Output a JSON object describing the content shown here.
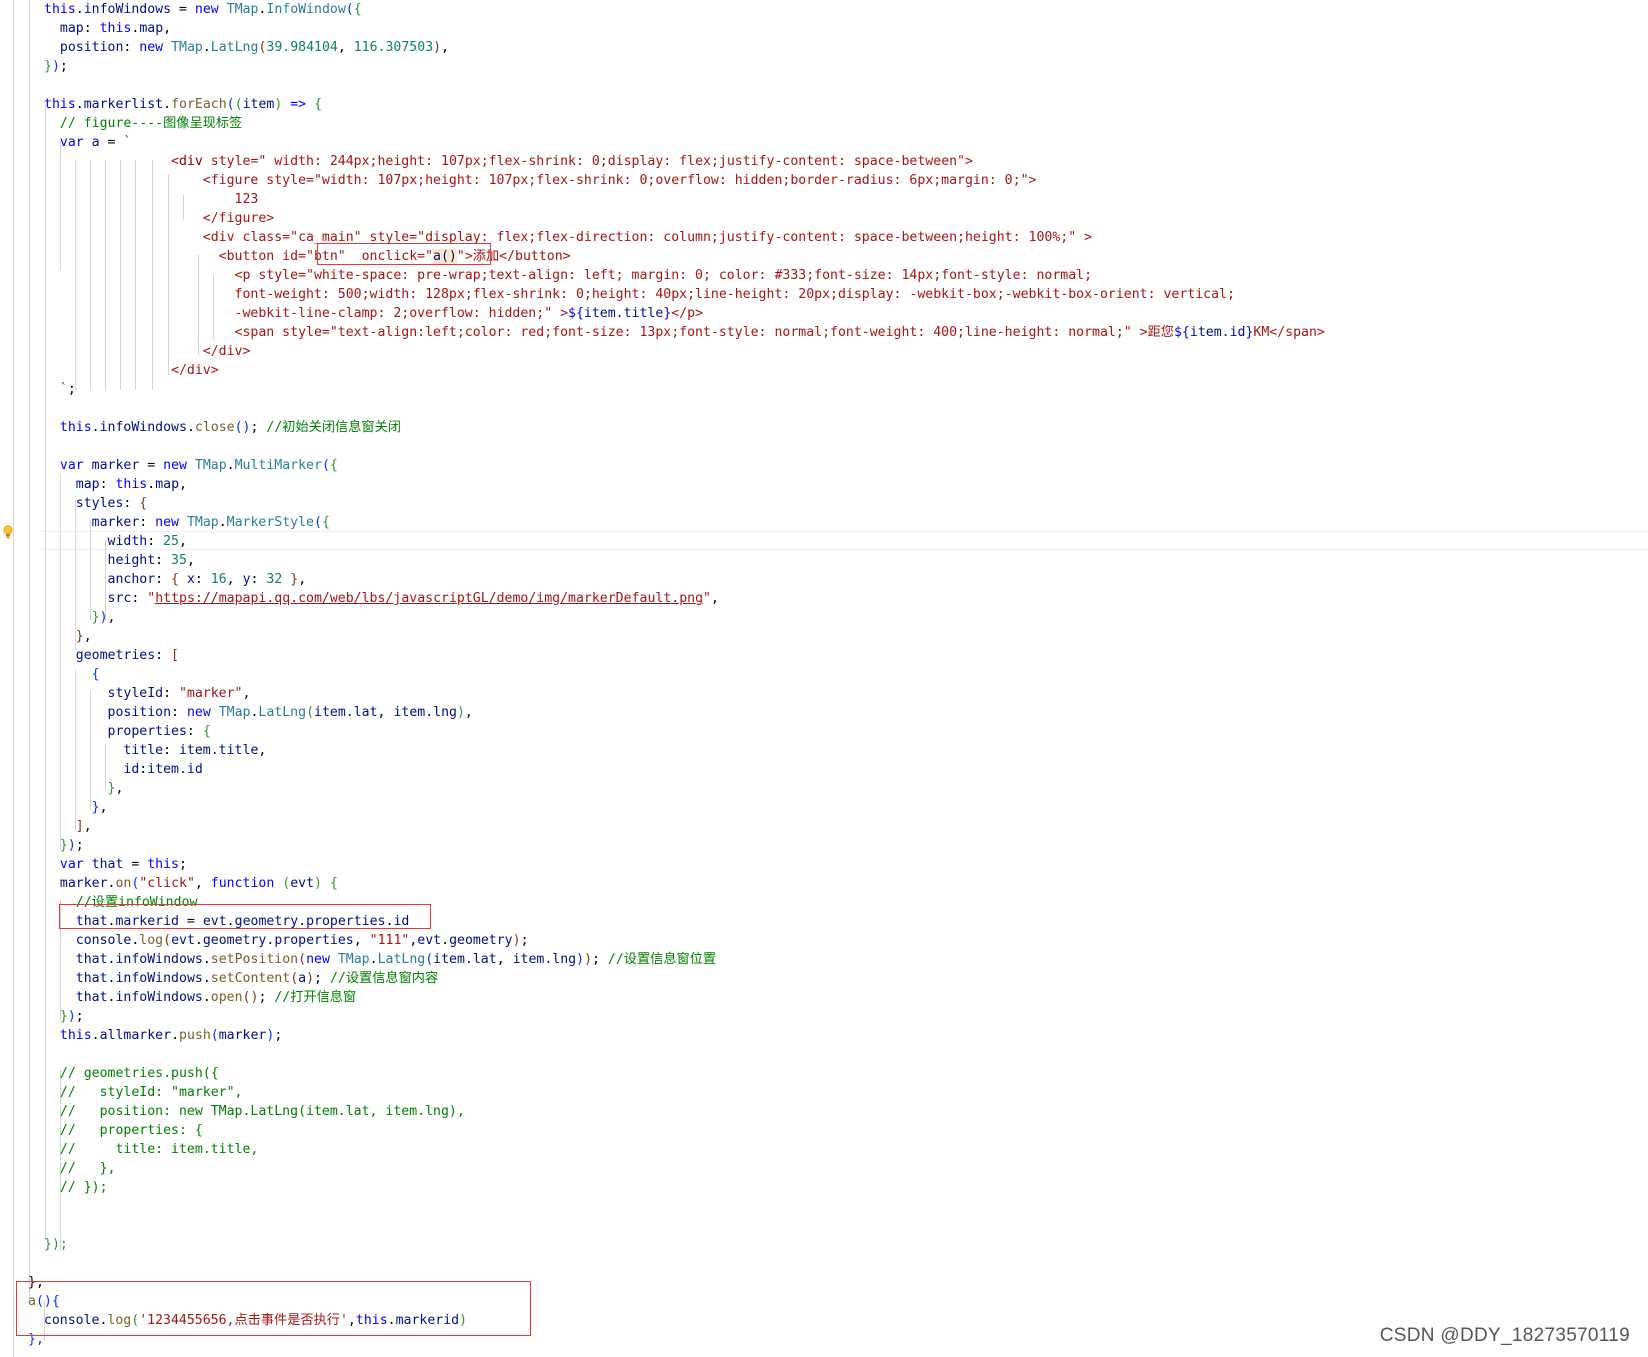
{
  "editor": {
    "code_lines": [
      [
        [
          "t-kw",
          "this"
        ],
        [
          "t-op",
          "."
        ],
        [
          "t-pr",
          "infoWindows"
        ],
        [
          "t-op",
          " = "
        ],
        [
          "t-kw",
          "new "
        ],
        [
          "t-cl",
          "TMap"
        ],
        [
          "t-op",
          "."
        ],
        [
          "t-cl",
          "InfoWindow"
        ],
        [
          "t-b1",
          "("
        ],
        [
          "t-b2",
          "{"
        ]
      ],
      [
        [
          "t-pr",
          "  map"
        ],
        [
          "t-op",
          ": "
        ],
        [
          "t-kw",
          "this"
        ],
        [
          "t-op",
          "."
        ],
        [
          "t-pr",
          "map"
        ],
        [
          "t-op",
          ","
        ]
      ],
      [
        [
          "t-pr",
          "  position"
        ],
        [
          "t-op",
          ": "
        ],
        [
          "t-kw",
          "new "
        ],
        [
          "t-cl",
          "TMap"
        ],
        [
          "t-op",
          "."
        ],
        [
          "t-cl",
          "LatLng"
        ],
        [
          "t-b3",
          "("
        ],
        [
          "t-nm",
          "39.984104"
        ],
        [
          "t-op",
          ", "
        ],
        [
          "t-nm",
          "116.307503"
        ],
        [
          "t-b3",
          ")"
        ],
        [
          "t-op",
          ","
        ]
      ],
      [
        [
          "t-b2",
          "}"
        ],
        [
          "t-b1",
          ")"
        ],
        [
          "t-op",
          ";"
        ]
      ],
      [],
      [
        [
          "t-kw",
          "this"
        ],
        [
          "t-op",
          "."
        ],
        [
          "t-pr",
          "markerlist"
        ],
        [
          "t-op",
          "."
        ],
        [
          "t-fn",
          "forEach"
        ],
        [
          "t-b1",
          "("
        ],
        [
          "t-b2",
          "("
        ],
        [
          "t-pr",
          "item"
        ],
        [
          "t-b2",
          ")"
        ],
        [
          "t-op",
          " "
        ],
        [
          "t-kw",
          "=>"
        ],
        [
          "t-op",
          " "
        ],
        [
          "t-b2",
          "{"
        ]
      ],
      [
        [
          "t-cm",
          "  // figure----图像呈现标签"
        ]
      ],
      [
        [
          "t-kw",
          "  var "
        ],
        [
          "t-pr",
          "a"
        ],
        [
          "t-op",
          " = "
        ],
        [
          "t-st",
          "`"
        ]
      ],
      [
        [
          "t-st",
          "                <"
        ],
        [
          "t-tag",
          "div"
        ],
        [
          "t-st",
          " style=\" width: 244px;height: 107px;flex-shrink: 0;display: flex;justify-content: space-between\">"
        ]
      ],
      [
        [
          "t-st",
          "                    <figure style=\"width: 107px;height: 107px;flex-shrink: 0;overflow: hidden;border-radius: 6px;margin: 0;\">"
        ]
      ],
      [
        [
          "t-st",
          "                        123"
        ]
      ],
      [
        [
          "t-st",
          "                    </figure>"
        ]
      ],
      [
        [
          "t-st",
          "                    <div class=\"ca_main\" style=\"display: flex;flex-direction: column;justify-content: space-between;height: 100%;\" >"
        ]
      ],
      [
        [
          "t-st",
          "                      <button id=\"btn\"  onclick=\""
        ],
        [
          "t-hl",
          "a()"
        ],
        [
          "t-st",
          "\">添加</button>"
        ]
      ],
      [
        [
          "t-st",
          "                        <p style=\"white-space: pre-wrap;text-align: left; margin: 0; color: #333;font-size: 14px;font-style: normal;"
        ]
      ],
      [
        [
          "t-st",
          "                        font-weight: 500;width: 128px;flex-shrink: 0;height: 40px;line-height: 20px;display: -webkit-box;-webkit-box-orient: vertical;"
        ]
      ],
      [
        [
          "t-st",
          "                        -webkit-line-clamp: 2;overflow: hidden;\" >"
        ],
        [
          "t-kw",
          "${"
        ],
        [
          "t-pr",
          "item.title"
        ],
        [
          "t-kw",
          "}"
        ],
        [
          "t-st",
          "</p>"
        ]
      ],
      [
        [
          "t-st",
          "                        <span style=\"text-align:left;color: red;font-size: 13px;font-style: normal;font-weight: 400;line-height: normal;\" >距您"
        ],
        [
          "t-kw",
          "${"
        ],
        [
          "t-pr",
          "item.id"
        ],
        [
          "t-kw",
          "}"
        ],
        [
          "t-st",
          "KM</span>"
        ]
      ],
      [
        [
          "t-st",
          "                    </div>"
        ]
      ],
      [
        [
          "t-st",
          "                </div>"
        ]
      ],
      [
        [
          "t-st",
          "  `"
        ],
        [
          "t-op",
          ";"
        ]
      ],
      [],
      [
        [
          "t-kw",
          "  this"
        ],
        [
          "t-op",
          "."
        ],
        [
          "t-pr",
          "infoWindows"
        ],
        [
          "t-op",
          "."
        ],
        [
          "t-fn",
          "close"
        ],
        [
          "t-b1",
          "()"
        ],
        [
          "t-op",
          "; "
        ],
        [
          "t-cm",
          "//初始关闭信息窗关闭"
        ]
      ],
      [],
      [
        [
          "t-kw",
          "  var "
        ],
        [
          "t-pr",
          "marker"
        ],
        [
          "t-op",
          " = "
        ],
        [
          "t-kw",
          "new "
        ],
        [
          "t-cl",
          "TMap"
        ],
        [
          "t-op",
          "."
        ],
        [
          "t-cl",
          "MultiMarker"
        ],
        [
          "t-b1",
          "("
        ],
        [
          "t-b2",
          "{"
        ]
      ],
      [
        [
          "t-pr",
          "    map"
        ],
        [
          "t-op",
          ": "
        ],
        [
          "t-kw",
          "this"
        ],
        [
          "t-op",
          "."
        ],
        [
          "t-pr",
          "map"
        ],
        [
          "t-op",
          ","
        ]
      ],
      [
        [
          "t-pr",
          "    styles"
        ],
        [
          "t-op",
          ": "
        ],
        [
          "t-b3",
          "{"
        ]
      ],
      [
        [
          "t-pr",
          "      marker"
        ],
        [
          "t-op",
          ": "
        ],
        [
          "t-kw",
          "new "
        ],
        [
          "t-cl",
          "TMap"
        ],
        [
          "t-op",
          "."
        ],
        [
          "t-cl",
          "MarkerStyle"
        ],
        [
          "t-b1",
          "("
        ],
        [
          "t-b2",
          "{"
        ]
      ],
      [
        [
          "t-pr",
          "        width"
        ],
        [
          "t-op",
          ": "
        ],
        [
          "t-nm",
          "25"
        ],
        [
          "t-op",
          ","
        ]
      ],
      [
        [
          "t-pr",
          "        height"
        ],
        [
          "t-op",
          ": "
        ],
        [
          "t-nm",
          "35"
        ],
        [
          "t-op",
          ","
        ]
      ],
      [
        [
          "t-pr",
          "        anchor"
        ],
        [
          "t-op",
          ": "
        ],
        [
          "t-b3",
          "{"
        ],
        [
          "t-pr",
          " x"
        ],
        [
          "t-op",
          ": "
        ],
        [
          "t-nm",
          "16"
        ],
        [
          "t-op",
          ", "
        ],
        [
          "t-pr",
          "y"
        ],
        [
          "t-op",
          ": "
        ],
        [
          "t-nm",
          "32"
        ],
        [
          "t-op",
          " "
        ],
        [
          "t-b3",
          "}"
        ],
        [
          "t-op",
          ","
        ]
      ],
      [
        [
          "t-pr",
          "        src"
        ],
        [
          "t-op",
          ": "
        ],
        [
          "t-st",
          "\""
        ],
        [
          "t-url",
          "https://mapapi.qq.com/web/lbs/javascriptGL/demo/img/markerDefault.png"
        ],
        [
          "t-st",
          "\""
        ],
        [
          "t-op",
          ","
        ]
      ],
      [
        [
          "t-b2",
          "      }"
        ],
        [
          "t-b1",
          ")"
        ],
        [
          "t-op",
          ","
        ]
      ],
      [
        [
          "t-b3",
          "    }"
        ],
        [
          "t-op",
          ","
        ]
      ],
      [
        [
          "t-pr",
          "    geometries"
        ],
        [
          "t-op",
          ": "
        ],
        [
          "t-b3",
          "["
        ]
      ],
      [
        [
          "t-b1",
          "      {"
        ]
      ],
      [
        [
          "t-pr",
          "        styleId"
        ],
        [
          "t-op",
          ": "
        ],
        [
          "t-st",
          "\"marker\""
        ],
        [
          "t-op",
          ","
        ]
      ],
      [
        [
          "t-pr",
          "        position"
        ],
        [
          "t-op",
          ": "
        ],
        [
          "t-kw",
          "new "
        ],
        [
          "t-cl",
          "TMap"
        ],
        [
          "t-op",
          "."
        ],
        [
          "t-cl",
          "LatLng"
        ],
        [
          "t-b2",
          "("
        ],
        [
          "t-pr",
          "item.lat"
        ],
        [
          "t-op",
          ", "
        ],
        [
          "t-pr",
          "item.lng"
        ],
        [
          "t-b2",
          ")"
        ],
        [
          "t-op",
          ","
        ]
      ],
      [
        [
          "t-pr",
          "        properties"
        ],
        [
          "t-op",
          ": "
        ],
        [
          "t-b2",
          "{"
        ]
      ],
      [
        [
          "t-pr",
          "          title"
        ],
        [
          "t-op",
          ": "
        ],
        [
          "t-pr",
          "item.title"
        ],
        [
          "t-op",
          ","
        ]
      ],
      [
        [
          "t-pr",
          "          id"
        ],
        [
          "t-op",
          ":"
        ],
        [
          "t-pr",
          "item.id"
        ]
      ],
      [
        [
          "t-b2",
          "        }"
        ],
        [
          "t-op",
          ","
        ]
      ],
      [
        [
          "t-b1",
          "      }"
        ],
        [
          "t-op",
          ","
        ]
      ],
      [
        [
          "t-b3",
          "    ]"
        ],
        [
          "t-op",
          ","
        ]
      ],
      [
        [
          "t-b2",
          "  }"
        ],
        [
          "t-b1",
          ")"
        ],
        [
          "t-op",
          ";"
        ]
      ],
      [
        [
          "t-kw",
          "  var "
        ],
        [
          "t-pr",
          "that"
        ],
        [
          "t-op",
          " = "
        ],
        [
          "t-kw",
          "this"
        ],
        [
          "t-op",
          ";"
        ]
      ],
      [
        [
          "t-pr",
          "  marker"
        ],
        [
          "t-op",
          "."
        ],
        [
          "t-fn",
          "on"
        ],
        [
          "t-b1",
          "("
        ],
        [
          "t-st",
          "\"click\""
        ],
        [
          "t-op",
          ", "
        ],
        [
          "t-kw",
          "function "
        ],
        [
          "t-b2",
          "("
        ],
        [
          "t-pr",
          "evt"
        ],
        [
          "t-b2",
          ")"
        ],
        [
          "t-op",
          " "
        ],
        [
          "t-b2",
          "{"
        ]
      ],
      [
        [
          "t-cm",
          "    //设置infoWindow"
        ]
      ],
      [
        [
          "t-pr",
          "    that"
        ],
        [
          "t-op",
          "."
        ],
        [
          "t-pr",
          "markerid"
        ],
        [
          "t-op",
          " = "
        ],
        [
          "t-pr",
          "evt"
        ],
        [
          "t-op",
          "."
        ],
        [
          "t-pr",
          "geometry"
        ],
        [
          "t-op",
          "."
        ],
        [
          "t-pr",
          "properties"
        ],
        [
          "t-op",
          "."
        ],
        [
          "t-pr",
          "id"
        ]
      ],
      [
        [
          "t-pr",
          "    console"
        ],
        [
          "t-op",
          "."
        ],
        [
          "t-fn",
          "log"
        ],
        [
          "t-b3",
          "("
        ],
        [
          "t-pr",
          "evt"
        ],
        [
          "t-op",
          "."
        ],
        [
          "t-pr",
          "geometry"
        ],
        [
          "t-op",
          "."
        ],
        [
          "t-pr",
          "properties"
        ],
        [
          "t-op",
          ", "
        ],
        [
          "t-st",
          "\"111\""
        ],
        [
          "t-op",
          ","
        ],
        [
          "t-pr",
          "evt"
        ],
        [
          "t-op",
          "."
        ],
        [
          "t-pr",
          "geometry"
        ],
        [
          "t-b3",
          ")"
        ],
        [
          "t-op",
          ";"
        ]
      ],
      [
        [
          "t-pr",
          "    that"
        ],
        [
          "t-op",
          "."
        ],
        [
          "t-pr",
          "infoWindows"
        ],
        [
          "t-op",
          "."
        ],
        [
          "t-fn",
          "setPosition"
        ],
        [
          "t-b3",
          "("
        ],
        [
          "t-kw",
          "new "
        ],
        [
          "t-cl",
          "TMap"
        ],
        [
          "t-op",
          "."
        ],
        [
          "t-cl",
          "LatLng"
        ],
        [
          "t-b1",
          "("
        ],
        [
          "t-pr",
          "item.lat"
        ],
        [
          "t-op",
          ", "
        ],
        [
          "t-pr",
          "item.lng"
        ],
        [
          "t-b1",
          ")"
        ],
        [
          "t-b3",
          ")"
        ],
        [
          "t-op",
          "; "
        ],
        [
          "t-cm",
          "//设置信息窗位置"
        ]
      ],
      [
        [
          "t-pr",
          "    that"
        ],
        [
          "t-op",
          "."
        ],
        [
          "t-pr",
          "infoWindows"
        ],
        [
          "t-op",
          "."
        ],
        [
          "t-fn",
          "setContent"
        ],
        [
          "t-b3",
          "("
        ],
        [
          "t-pr",
          "a"
        ],
        [
          "t-b3",
          ")"
        ],
        [
          "t-op",
          "; "
        ],
        [
          "t-cm",
          "//设置信息窗内容"
        ]
      ],
      [
        [
          "t-pr",
          "    that"
        ],
        [
          "t-op",
          "."
        ],
        [
          "t-pr",
          "infoWindows"
        ],
        [
          "t-op",
          "."
        ],
        [
          "t-fn",
          "open"
        ],
        [
          "t-b3",
          "()"
        ],
        [
          "t-op",
          "; "
        ],
        [
          "t-cm",
          "//打开信息窗"
        ]
      ],
      [
        [
          "t-b2",
          "  }"
        ],
        [
          "t-b1",
          ")"
        ],
        [
          "t-op",
          ";"
        ]
      ],
      [
        [
          "t-kw",
          "  this"
        ],
        [
          "t-op",
          "."
        ],
        [
          "t-pr",
          "allmarker"
        ],
        [
          "t-op",
          "."
        ],
        [
          "t-fn",
          "push"
        ],
        [
          "t-b1",
          "("
        ],
        [
          "t-pr",
          "marker"
        ],
        [
          "t-b1",
          ")"
        ],
        [
          "t-op",
          ";"
        ]
      ],
      [],
      [
        [
          "t-cm",
          "  // geometries.push({"
        ]
      ],
      [
        [
          "t-cm",
          "  //   styleId: \"marker\","
        ]
      ],
      [
        [
          "t-cm",
          "  //   position: new TMap.LatLng(item.lat, item.lng),"
        ]
      ],
      [
        [
          "t-cm",
          "  //   properties: {"
        ]
      ],
      [
        [
          "t-cm",
          "  //     title: item.title,"
        ]
      ],
      [
        [
          "t-cm",
          "  //   },"
        ]
      ],
      [
        [
          "t-cm",
          "  // });"
        ]
      ],
      [],
      [],
      [
        [
          "t-b2",
          "});"
        ]
      ],
      [],
      [
        [
          "t-op",
          "},"
        ]
      ],
      [
        [
          "t-fn",
          "a"
        ],
        [
          "t-b1",
          "()"
        ],
        [
          "t-b1",
          "{"
        ]
      ],
      [
        [
          "t-pr",
          "  console"
        ],
        [
          "t-op",
          "."
        ],
        [
          "t-fn",
          "log"
        ],
        [
          "t-b2",
          "("
        ],
        [
          "t-st",
          "'1234455656,点击事件是否执行'"
        ],
        [
          "t-op",
          ","
        ],
        [
          "t-kw",
          "this"
        ],
        [
          "t-op",
          "."
        ],
        [
          "t-pr",
          "markerid"
        ],
        [
          "t-b2",
          ")"
        ]
      ],
      [
        [
          "t-b1",
          "},"
        ]
      ]
    ]
  },
  "watermark": "CSDN @DDY_18273570119"
}
